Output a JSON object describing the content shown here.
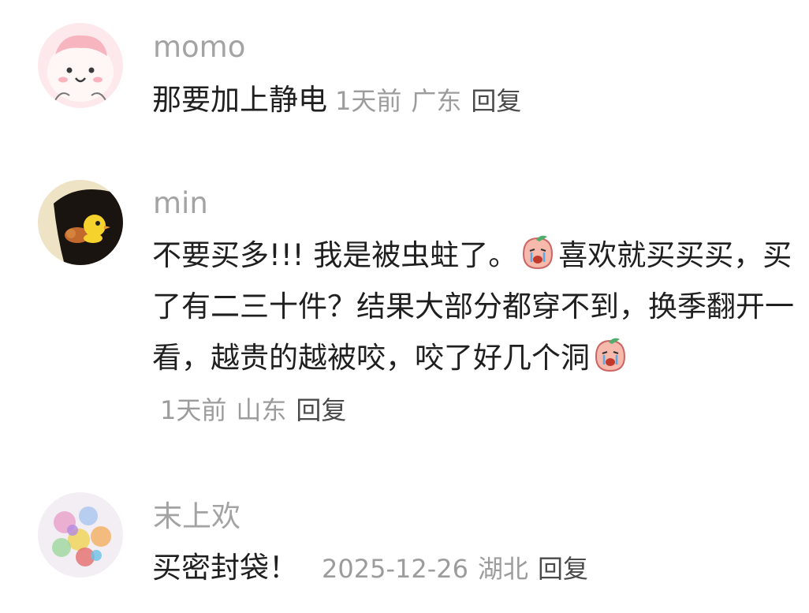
{
  "comments": [
    {
      "username": "momo",
      "text": "那要加上静电",
      "time": "1天前",
      "location": "广东",
      "reply_label": "回复"
    },
    {
      "username": "min",
      "text_part1": "不要买多!!! 我是被虫蛀了。",
      "text_part2": "喜欢就买买买，买了有二三十件？结果大部分都穿不到，换季翻开一看，越贵的越被咬，咬了好几个洞",
      "emoji": "crying-peach-emoji",
      "time": "1天前",
      "location": "山东",
      "reply_label": "回复"
    },
    {
      "username": "末上欢",
      "text": "买密封袋！",
      "time": "2025-12-26",
      "location": "湖北",
      "reply_label": "回复"
    }
  ]
}
